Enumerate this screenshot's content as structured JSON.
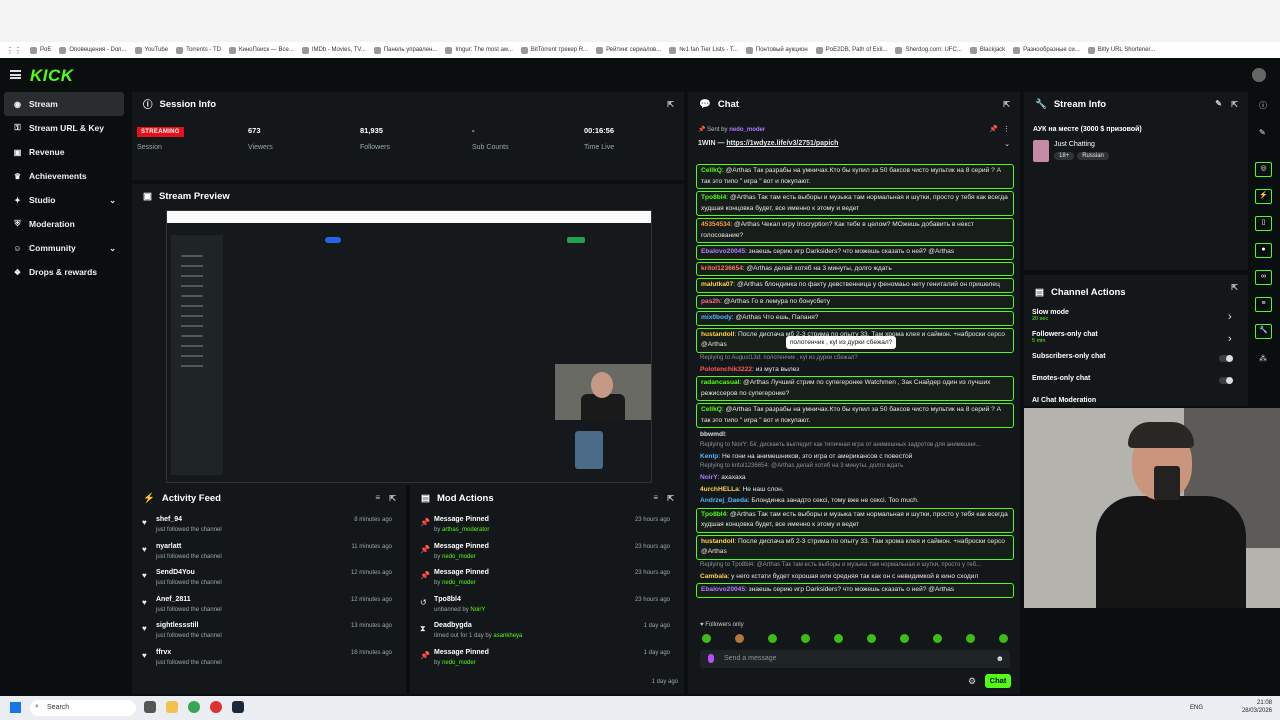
{
  "browser": {
    "bookmarks": [
      "PoE",
      "Оповещения - Don...",
      "YouTube",
      "Torrents - TD",
      "КиноПоиск — Все...",
      "IMDb - Movies, TV...",
      "Панель управлен...",
      "Imgur: The most aw...",
      "BitTorrent трекер R...",
      "Рейтинг сериалов...",
      "№1 fan Tier Lists - T...",
      "Понтовый аукцион",
      "PoE2DB, Path of Exil...",
      "Sherdog.com: UFC...",
      "Blackjack",
      "Разнообразные си...",
      "Bitly URL Shortener..."
    ]
  },
  "brand": {
    "logo": "KICK",
    "accent": "#53fc18",
    "live_color": "#e5101a"
  },
  "sidebar": {
    "items": [
      {
        "label": "Stream",
        "icon": "broadcast-icon",
        "active": true
      },
      {
        "label": "Stream URL & Key",
        "icon": "key-icon"
      },
      {
        "label": "Revenue",
        "icon": "wallet-icon"
      },
      {
        "label": "Achievements",
        "icon": "trophy-icon"
      },
      {
        "label": "Studio",
        "icon": "palette-icon",
        "expandable": true
      },
      {
        "label": "Moderation",
        "icon": "shield-icon"
      },
      {
        "label": "Community",
        "icon": "people-icon",
        "expandable": true
      },
      {
        "label": "Drops & rewards",
        "icon": "gift-icon"
      }
    ]
  },
  "session": {
    "title": "Session Info",
    "status": "STREAMING",
    "status_label": "Session",
    "stats": [
      {
        "value": "673",
        "label": "Viewers"
      },
      {
        "value": "81,935",
        "label": "Followers"
      },
      {
        "value": "-",
        "label": "Sub Counts"
      },
      {
        "value": "00:16:56",
        "label": "Time Live"
      }
    ]
  },
  "preview": {
    "title": "Stream Preview"
  },
  "activity": {
    "title": "Activity Feed",
    "items": [
      {
        "name": "shef_94",
        "action": "just followed the channel",
        "time": "8 minutes ago"
      },
      {
        "name": "nyarlatt",
        "action": "just followed the channel",
        "time": "11 minutes ago"
      },
      {
        "name": "SendD4You",
        "action": "just followed the channel",
        "time": "12 minutes ago"
      },
      {
        "name": "Anef_2811",
        "action": "just followed the channel",
        "time": "12 minutes ago"
      },
      {
        "name": "sightlessstill",
        "action": "just followed the channel",
        "time": "13 minutes ago"
      },
      {
        "name": "ffrvx",
        "action": "just followed the channel",
        "time": "16 minutes ago"
      }
    ]
  },
  "mod_actions": {
    "title": "Mod Actions",
    "items": [
      {
        "action": "Message Pinned",
        "prefix": "by",
        "who": "arthas_moderator",
        "time": "23 hours ago",
        "icon": "pin-icon"
      },
      {
        "action": "Message Pinned",
        "prefix": "by",
        "who": "nedo_moder",
        "time": "23 hours ago",
        "icon": "pin-icon"
      },
      {
        "action": "Message Pinned",
        "prefix": "by",
        "who": "nedo_moder",
        "time": "23 hours ago",
        "icon": "pin-icon"
      },
      {
        "action": "Tpo8bl4",
        "prefix": "unbanned by",
        "who": "NoirY",
        "time": "23 hours ago",
        "icon": "undo-icon"
      },
      {
        "action": "Deadbygda",
        "prefix": "timed out for 1 day by",
        "who": "asankheya",
        "time": "1 day ago",
        "icon": "hourglass-icon"
      },
      {
        "action": "Message Pinned",
        "prefix": "by",
        "who": "nedo_moder",
        "time": "1 day ago",
        "icon": "pin-icon"
      }
    ],
    "last_time": "1 day ago"
  },
  "chat": {
    "title": "Chat",
    "pinned": {
      "by_prefix": "Sent by",
      "by": "nedo_moder",
      "text": "1WIN —",
      "link": "https://1wdyze.life/v3/2751/papich"
    },
    "messages": [
      {
        "user": "CellkQ",
        "color": "#53fc18",
        "text": "@Arthas Так разрабы на умничах.Кто бы купил за 50 баксов чисто мультик на 8 серий ? А так это типо \" игра \" вот и покупают.",
        "hl": true,
        "lines": 2
      },
      {
        "user": "Tpo8bl4",
        "color": "#53fc18",
        "text": "@Arthas Так там есть выборы и музыка там нормальная и шутки, просто у тебя как всегда худшая концовка будет, все именно к этому и ведет",
        "hl": true,
        "lines": 2
      },
      {
        "user": "45354534",
        "color": "#ff9a3c",
        "text": "@Arthas Чекал игру Inscryption? Как тебе в целом? МОжешь добавить в некст голосование?",
        "hl": true,
        "lines": 2
      },
      {
        "user": "Ebalovo20045",
        "color": "#b07cff",
        "text": "знаешь серию игр Darksiders? что можешь сказать о ней? @Arthas",
        "hl": true,
        "lines": 1
      },
      {
        "user": "kritol1236654",
        "color": "#ff7a5c",
        "text": "@Arthas делай хотяб на 3 минуты, долго ждать",
        "hl": true,
        "lines": 1
      },
      {
        "user": "malutka07",
        "color": "#ffd24a",
        "text": "@Arthas блондинка по факту девственница у феномаьо нету гениталий он пришелец",
        "hl": true,
        "lines": 1
      },
      {
        "user": "pas2h",
        "color": "#ff6f9a",
        "text": "@Arthas Го в лемура по бонусбету",
        "hl": true,
        "lines": 1
      },
      {
        "user": "mix0body",
        "color": "#4fb8ff",
        "text": "@Arthas Что ешь, Папаня?",
        "hl": true,
        "lines": 1
      },
      {
        "user": "hustandoll",
        "color": "#ffd24a",
        "text": "После диспача мб 2-3 стрима по опыту 33. Там хрома клея и саймон. +наброски серсо @Arthas",
        "hl": true,
        "lines": 2
      },
      {
        "user": "Polotenchik3222",
        "color": "#ff5a5a",
        "text": "из мута вылез",
        "hl": false,
        "lines": 1,
        "reply": "Replying to August13d: полотенчик , куl из дурки сбежал?"
      },
      {
        "user": "radancasual",
        "color": "#53fc18",
        "text": "@Arthas Лучший стрим по супегеронке Watchmen , Зак Снайдер один из лучших режиссеров по супегеронке?",
        "hl": true,
        "lines": 2
      },
      {
        "user": "CellkQ",
        "color": "#53fc18",
        "text": "@Arthas Так разрабы на умничах.Кто бы купил за 50 баксов чисто мультик на 8 серий ? А так это типо \" игра \" вот и покупают.",
        "hl": true,
        "lines": 2
      },
      {
        "user": "bbwmdl",
        "color": "#dddddd",
        "text": "",
        "hl": false,
        "lines": 1
      },
      {
        "user": "Kenlp",
        "color": "#4fb8ff",
        "text": "Не гони на анимешников, это игра от американсов с повестой",
        "hl": false,
        "lines": 1,
        "reply": "Replying to NoirY: Біг, дискаеть выгледит как типичная игра от анимешных задротов для анимешни..."
      },
      {
        "user": "NoirY",
        "color": "#b07cff",
        "text": "ахахаха",
        "hl": false,
        "lines": 1,
        "reply": "Replying to kritol1236654: @Arthas делай хотяб на 3 минуты, долго ждать"
      },
      {
        "user": "4urchHELLa",
        "color": "#ffd24a",
        "text": "Не наш слон.",
        "hl": false,
        "lines": 1
      },
      {
        "user": "Andrzej_Daeda",
        "color": "#4fb8ff",
        "text": "Блондинка занадто сексі, тому вже не сексі. Too much.",
        "hl": false,
        "lines": 1
      },
      {
        "user": "Tpo8bl4",
        "color": "#53fc18",
        "text": "@Arthas Так там есть выборы и музыка там нормальная и шутки, просто у тебя как всегда худшая концовка будет, все именно к этому и ведет",
        "hl": true,
        "lines": 2
      },
      {
        "user": "hustandoll",
        "color": "#ffd24a",
        "text": "После диспача мб 2-3 стрима по опыту 33. Там хрома клея и саймон. +наброски серсо @Arthas",
        "hl": true,
        "lines": 2
      },
      {
        "user": "Cambala",
        "color": "#ffd24a",
        "text": "у него кстати будет хорошая или средняя так как он с невидимкой в кино сходил",
        "hl": false,
        "lines": 1,
        "reply": "Replying to Tpo8bl4: @Arthas Так там есть выборы и музыка там нормальная и шутки, просто у теб..."
      },
      {
        "user": "Ebalovo20045",
        "color": "#b07cff",
        "text": "знаешь серию игр Darksiders? что можешь сказать о ней? @Arthas",
        "hl": true,
        "lines": 1
      }
    ],
    "tooltip": "полотенчик , куl из дурки сбежал?",
    "followers_only": "Followers only",
    "placeholder": "Send a message",
    "send": "Chat"
  },
  "stream_info": {
    "title": "Stream Info",
    "stream_title": "АУК на месте (3000 $ призовой)",
    "category": "Just Chatting",
    "tags": [
      "18+",
      "Russian"
    ]
  },
  "channel_actions": {
    "title": "Channel Actions",
    "items": [
      {
        "label": "Slow mode",
        "sub": "20 sec",
        "control": "chevron"
      },
      {
        "label": "Followers-only chat",
        "sub": "5 min",
        "control": "chevron"
      },
      {
        "label": "Subscribers-only chat",
        "sub": "",
        "control": "toggle"
      },
      {
        "label": "Emotes-only chat",
        "sub": "",
        "control": "toggle"
      },
      {
        "label": "AI Chat Moderation",
        "sub": "",
        "control": "none"
      }
    ]
  },
  "taskbar": {
    "search": "Search",
    "lang": "ENG",
    "time": "21:08",
    "date": "28/03/2026"
  }
}
